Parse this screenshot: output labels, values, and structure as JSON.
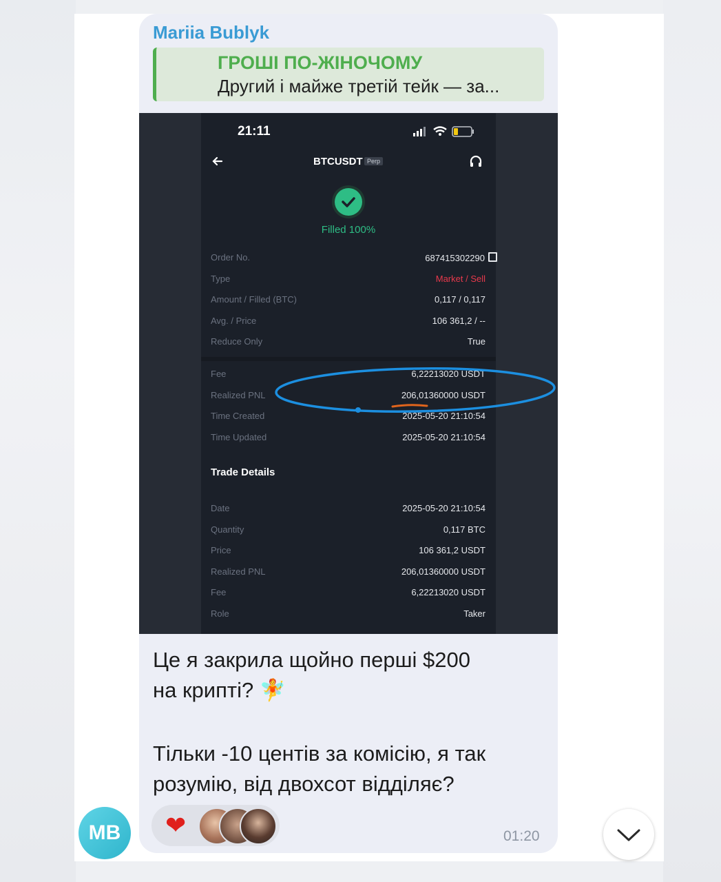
{
  "message": {
    "sender": "Mariia Bublyk",
    "reply_title": "ГРОШІ ПО-ЖІНОЧОМУ",
    "reply_text": "Другий і майже третій тейк — за...",
    "text_line1": "Це я закрила щойно перші $200",
    "text_line2": "на крипті? 🧚",
    "text_line3": "Тільки -10 центів за комісію, я так",
    "text_line4": "розумію, від двохсот відділяє?",
    "time": "01:20",
    "reaction": "❤",
    "avatar_initials": "MB"
  },
  "screenshot": {
    "status_time": "21:11",
    "pair": "BTCUSDT",
    "badge": "Perp",
    "status": "Filled 100%",
    "rows": [
      {
        "label": "Order No.",
        "value": "687415302290"
      },
      {
        "label": "Type",
        "value": "Market / Sell"
      },
      {
        "label": "Amount / Filled (BTC)",
        "value": "0,117 / 0,117"
      },
      {
        "label": "Avg. / Price",
        "value": "106 361,2 / --"
      },
      {
        "label": "Reduce Only",
        "value": "True"
      },
      {
        "label": "Fee",
        "value": "6,22213020 USDT"
      },
      {
        "label": "Realized PNL",
        "value": "206,01360000 USDT"
      },
      {
        "label": "Time Created",
        "value": "2025-05-20 21:10:54"
      },
      {
        "label": "Time Updated",
        "value": "2025-05-20 21:10:54"
      }
    ],
    "trade_details_title": "Trade Details",
    "trade_rows": [
      {
        "label": "Date",
        "value": "2025-05-20 21:10:54"
      },
      {
        "label": "Quantity",
        "value": "0,117 BTC"
      },
      {
        "label": "Price",
        "value": "106 361,2 USDT"
      },
      {
        "label": "Realized PNL",
        "value": "206,01360000 USDT"
      },
      {
        "label": "Fee",
        "value": "6,22213020 USDT"
      },
      {
        "label": "Role",
        "value": "Taker"
      }
    ]
  },
  "colors": {
    "accent_green": "#2ebd85",
    "sell_red": "#e8394c",
    "sender_blue": "#3a9bd4",
    "reply_green": "#4fae4e"
  }
}
